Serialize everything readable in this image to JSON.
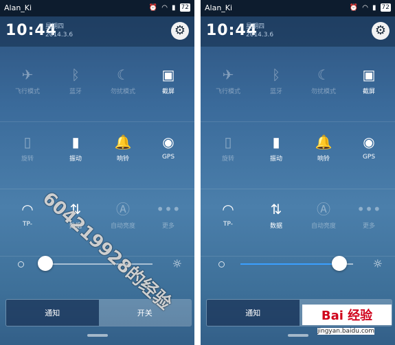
{
  "statusbar": {
    "carrier": "Alan_Ki",
    "battery": "72",
    "alarm_icon": "alarm-clock-icon",
    "wifi_icon": "wifi-icon",
    "signal_icon": "signal-icon"
  },
  "header": {
    "time": "10:44",
    "weekday": "星期四",
    "date": "2014.3.6"
  },
  "rows": [
    [
      {
        "label": "飞行模式",
        "icon": "airplane-icon",
        "glyph": "✈",
        "state": "off"
      },
      {
        "label": "蓝牙",
        "icon": "bluetooth-icon",
        "glyph": "ᛒ",
        "state": "off"
      },
      {
        "label": "勿扰模式",
        "icon": "moon-icon",
        "glyph": "☾",
        "state": "off"
      },
      {
        "label": "截屏",
        "icon": "screenshot-icon",
        "glyph": "▣",
        "state": "on"
      }
    ],
    [
      {
        "label": "旋转",
        "icon": "rotate-icon",
        "glyph": "▯",
        "state": "off"
      },
      {
        "label": "振动",
        "icon": "vibrate-icon",
        "glyph": "▮",
        "state": "on"
      },
      {
        "label": "响铃",
        "icon": "bell-icon",
        "glyph": "🔔",
        "state": "on"
      },
      {
        "label": "GPS",
        "icon": "gps-icon",
        "glyph": "◉",
        "state": "on"
      }
    ],
    [
      {
        "label": "TP-",
        "icon": "wifi-icon",
        "glyph": "◠",
        "state": "on"
      },
      {
        "label": "数据",
        "icon": "data-transfer-icon",
        "glyph": "⇅",
        "state": "on"
      },
      {
        "label": "自动亮度",
        "icon": "auto-brightness-icon",
        "glyph": "Ⓐ",
        "state": "off"
      },
      {
        "label": "更多",
        "icon": "more-icon",
        "glyph": "•••",
        "state": "off"
      }
    ]
  ],
  "panels": [
    {
      "brightness": 0.05,
      "active_tab": 1
    },
    {
      "brightness": 0.88,
      "active_tab": 1
    }
  ],
  "tabs": {
    "notify": "通知",
    "toggles": "开关"
  },
  "watermark": {
    "diagonal": "604219928的经验",
    "logo": "Bai 经验",
    "site": "jingyan.baidu.com"
  },
  "colors": {
    "accent": "#3aa0ff",
    "panel": "#3d6f98",
    "statusbar": "#0d1c2e"
  }
}
